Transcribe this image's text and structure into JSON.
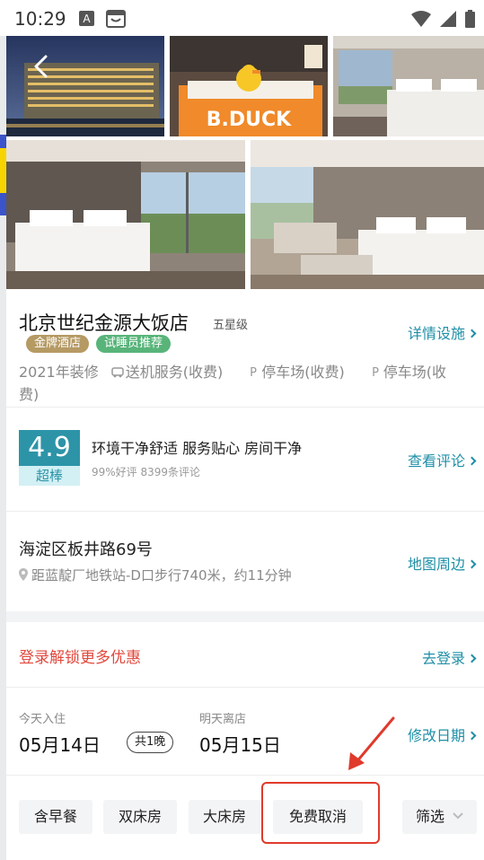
{
  "status_bar": {
    "time": "10:29",
    "icons": [
      "a-notification-icon",
      "store-icon",
      "wifi-icon",
      "signal-icon",
      "battery-icon"
    ]
  },
  "gallery": {
    "photos": [
      "hotel-exterior-photo",
      "bduck-room-photo",
      "twin-room-photo",
      "bed-window-photo",
      "bed-sofa-photo"
    ],
    "duck_text": "B.DUCK"
  },
  "hotel": {
    "name": "北京世纪金源大饭店",
    "star": "五星级",
    "tags": [
      "金牌酒店",
      "试睡员推荐"
    ],
    "detail_link": "详情设施",
    "facilities": [
      "2021年装修",
      "送机服务(收费)",
      "停车场(收费)",
      "停车场(收费)"
    ]
  },
  "reviews": {
    "score": "4.9",
    "score_word": "超棒",
    "title": "环境干净舒适 服务贴心 房间干净",
    "subtitle": "99%好评 8399条评论",
    "link": "查看评论"
  },
  "location": {
    "address": "海淀区板井路69号",
    "distance": "距蓝靛厂地铁站-D口步行740米，约11分钟",
    "link": "地图周边"
  },
  "promo": {
    "text": "登录解锁更多优惠",
    "link": "去登录"
  },
  "dates": {
    "checkin_label": "今天入住",
    "checkin_date": "05月14日",
    "nights": "共1晚",
    "checkout_label": "明天离店",
    "checkout_date": "05月15日",
    "modify_link": "修改日期"
  },
  "filters": {
    "chips": [
      "含早餐",
      "双床房",
      "大床房",
      "免费取消"
    ],
    "filter_label": "筛选"
  },
  "colors": {
    "accent": "#1f8fa7",
    "score_bg": "#2d94a8",
    "promo_red": "#e2483d",
    "annotation_red": "#e03a2b",
    "tag_gold": "#b59a64",
    "tag_green": "#59b47a"
  }
}
